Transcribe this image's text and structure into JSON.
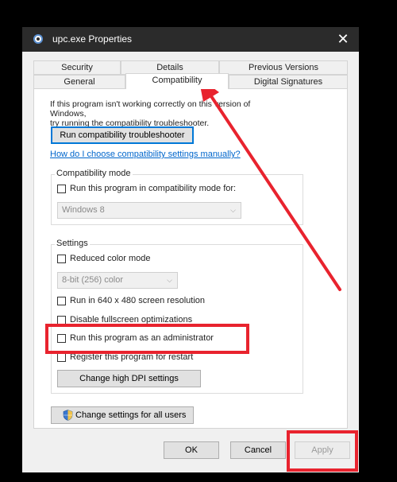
{
  "window": {
    "title": "upc.exe Properties",
    "close_glyph": "✕"
  },
  "tabs": {
    "row1": [
      "Security",
      "Details",
      "Previous Versions"
    ],
    "row2": [
      "General",
      "Compatibility",
      "Digital Signatures"
    ],
    "active": "Compatibility"
  },
  "intro": {
    "line1": "If this program isn't working correctly on this version of Windows,",
    "line2": "try running the compatibility troubleshooter."
  },
  "troubleshooter_button": "Run compatibility troubleshooter",
  "help_link": "How do I choose compatibility settings manually?",
  "compat_mode": {
    "legend": "Compatibility mode",
    "checkbox_label": "Run this program in compatibility mode for:",
    "checked": false,
    "select_value": "Windows 8"
  },
  "settings": {
    "legend": "Settings",
    "reduced_color": {
      "label": "Reduced color mode",
      "checked": false
    },
    "color_select": "8-bit (256) color",
    "res_640": {
      "label": "Run in 640 x 480 screen resolution",
      "checked": false
    },
    "disable_fullscreen": {
      "label": "Disable fullscreen optimizations",
      "checked": false
    },
    "run_as_admin": {
      "label": "Run this program as an administrator",
      "checked": false
    },
    "register_restart": {
      "label": "Register this program for restart",
      "checked": false
    },
    "dpi_button": "Change high DPI settings"
  },
  "all_users_button": "Change settings for all users",
  "footer": {
    "ok": "OK",
    "cancel": "Cancel",
    "apply": "Apply"
  },
  "annotation_color": "#e8232e",
  "icons": [
    "app-icon",
    "close-icon",
    "shield-icon",
    "chevron-down-icon"
  ]
}
